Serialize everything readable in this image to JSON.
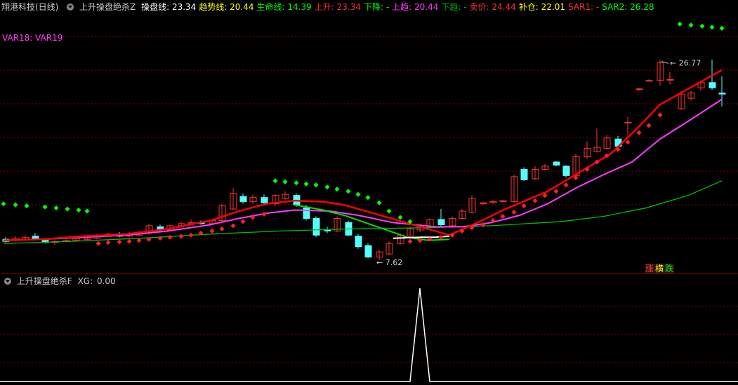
{
  "main_header": {
    "stock": "翔港科技(日线)",
    "indicator": "上升操盘绝杀Z",
    "items": [
      {
        "label": "操盘线:",
        "value": "23.34",
        "color": "#ffffff"
      },
      {
        "label": "趋势线:",
        "value": "20.44",
        "color": "#ffff00"
      },
      {
        "label": "生命线:",
        "value": "14.39",
        "color": "#00ff00"
      },
      {
        "label": "上升:",
        "value": "23.34",
        "color": "#ff3333"
      },
      {
        "label": "下降:",
        "value": "-",
        "color": "#00ff00"
      },
      {
        "label": "上趋:",
        "value": "20.44",
        "color": "#ff3cff"
      },
      {
        "label": "下趋:",
        "value": "-",
        "color": "#00b000"
      },
      {
        "label": "卖价:",
        "value": "24.44",
        "color": "#ff3333"
      },
      {
        "label": "补仓:",
        "value": "22.01",
        "color": "#ffff00"
      },
      {
        "label": "SAR1:",
        "value": "-",
        "color": "#ff3333"
      },
      {
        "label": "SAR2:",
        "value": "26.28",
        "color": "#00ff00"
      }
    ]
  },
  "var_label": "VAR18: VAR19",
  "annotations": {
    "high": "26.77",
    "low": "7.62"
  },
  "legend_tags": [
    {
      "text": "涨",
      "color": "#ff4040"
    },
    {
      "text": "横",
      "color": "#ffff00"
    },
    {
      "text": "跌",
      "color": "#00ff00"
    }
  ],
  "sub_header": {
    "indicator": "上升操盘绝杀F",
    "label": "XG:",
    "value": "0.00"
  },
  "colors": {
    "up": "#ff3333",
    "down": "#54ffff",
    "red_line": "#ff0000",
    "magenta_line": "#ff3cff",
    "green_line": "#00c000",
    "sar_green": "#00ff00",
    "grid": "#8b0000"
  }
}
